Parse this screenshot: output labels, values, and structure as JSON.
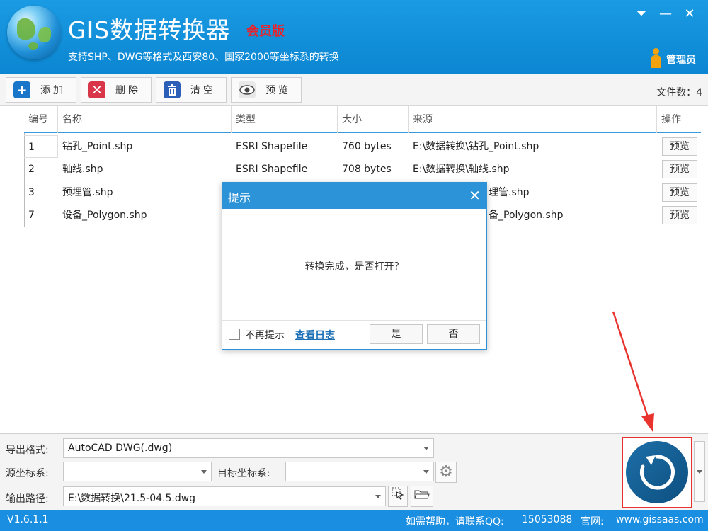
{
  "header": {
    "title": "GIS数据转换器",
    "edition": "会员版",
    "subtitle": "支持SHP、DWG等格式及西安80、国家2000等坐标系的转换",
    "user": "管理员",
    "controls": {
      "menu": "⏷",
      "minimize": "—",
      "close": "✕"
    }
  },
  "toolbar": {
    "add_label": "添加",
    "delete_label": "删除",
    "clear_label": "清空",
    "preview_label": "预览",
    "file_count_label": "文件数：4"
  },
  "table": {
    "columns": [
      "编号",
      "名称",
      "类型",
      "大小",
      "来源",
      "操作"
    ],
    "rows": [
      {
        "id": "1",
        "name": "钻孔_Point.shp",
        "type": "ESRI Shapefile",
        "size": "760 bytes",
        "source": "E:\\数据转换\\钻孔_Point.shp",
        "action": "预览"
      },
      {
        "id": "2",
        "name": "轴线.shp",
        "type": "ESRI Shapefile",
        "size": "708 bytes",
        "source": "E:\\数据转换\\轴线.shp",
        "action": "预览"
      },
      {
        "id": "3",
        "name": "预埋管.shp",
        "type": "",
        "size": "",
        "source": "理管.shp",
        "action": "预览"
      },
      {
        "id": "7",
        "name": "设备_Polygon.shp",
        "type": "",
        "size": "",
        "source": "备_Polygon.shp",
        "action": "预览"
      }
    ]
  },
  "dialog": {
    "title": "提示",
    "message": "转换完成，是否打开？",
    "dont_remind": "不再提示",
    "view_log": "查看日志",
    "yes": "是",
    "no": "否"
  },
  "bottom": {
    "export_format_label": "导出格式:",
    "export_format_value": "AutoCAD DWG(.dwg)",
    "src_crs_label": "源坐标系:",
    "src_crs_value": "",
    "dst_crs_label": "目标坐标系:",
    "dst_crs_value": "",
    "output_path_label": "输出路径:",
    "output_path_value": "E:\\数据转换\\21.5-04.5.dwg"
  },
  "status": {
    "version": "V1.6.1.1",
    "help": "如需帮助，请联系QQ:",
    "qq": "15053088",
    "site_label": "官网:",
    "site": "www.gissaas.com"
  },
  "colors": {
    "header_blue": "#0c86d2",
    "dialog_blue": "#2d93d8",
    "edition_red": "#e8232a",
    "annotation_red": "#e8332f",
    "status_blue": "#1a8ee0"
  }
}
